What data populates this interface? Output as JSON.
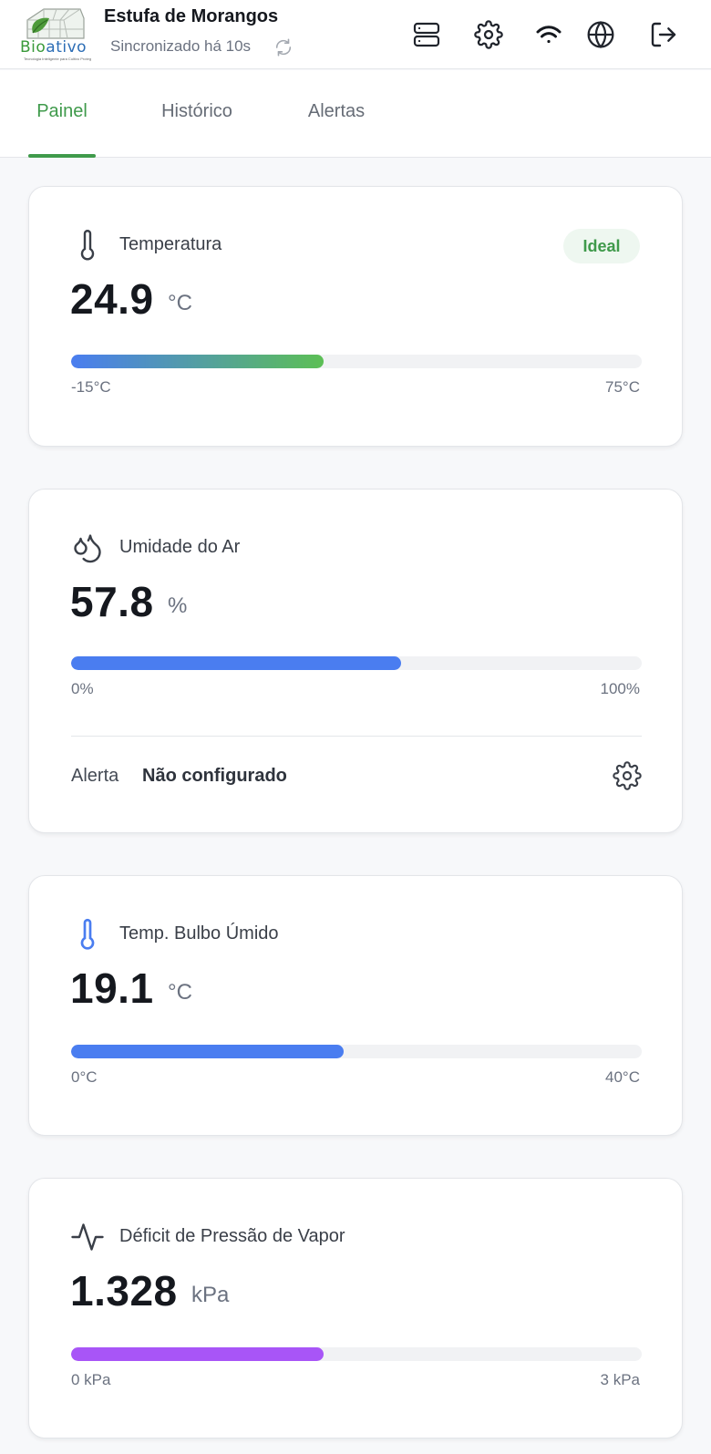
{
  "header": {
    "title": "Estufa de Morangos",
    "sync": "Sincronizado há 10s",
    "logo": {
      "part1": "Bio",
      "part2": "ativo",
      "tagline": "Tecnologia Inteligente para Cultivo Protegido"
    }
  },
  "tabs": [
    {
      "label": "Painel",
      "active": true
    },
    {
      "label": "Histórico",
      "active": false
    },
    {
      "label": "Alertas",
      "active": false
    }
  ],
  "cards": {
    "temperature": {
      "title": "Temperatura",
      "value": "24.9",
      "unit": "°C",
      "badge": "Ideal",
      "min": "-15°C",
      "max": "75°C",
      "fraction": 0.443
    },
    "humidity": {
      "title": "Umidade do Ar",
      "value": "57.8",
      "unit": "%",
      "min": "0%",
      "max": "100%",
      "fraction": 0.578,
      "alert_label": "Alerta",
      "alert_value": "Não configurado"
    },
    "wetbulb": {
      "title": "Temp. Bulbo Úmido",
      "value": "19.1",
      "unit": "°C",
      "min": "0°C",
      "max": "40°C",
      "fraction": 0.478
    },
    "vpd": {
      "title": "Déficit de Pressão de Vapor",
      "value": "1.328",
      "unit": "kPa",
      "min": "0 kPa",
      "max": "3 kPa",
      "fraction": 0.443
    }
  },
  "colors": {
    "accent": "#3f9a4b",
    "blue": "#4a7df0",
    "purple": "#a855f7",
    "temp_gradient_start": "#4a7df0",
    "temp_gradient_end": "#5cbf55"
  }
}
